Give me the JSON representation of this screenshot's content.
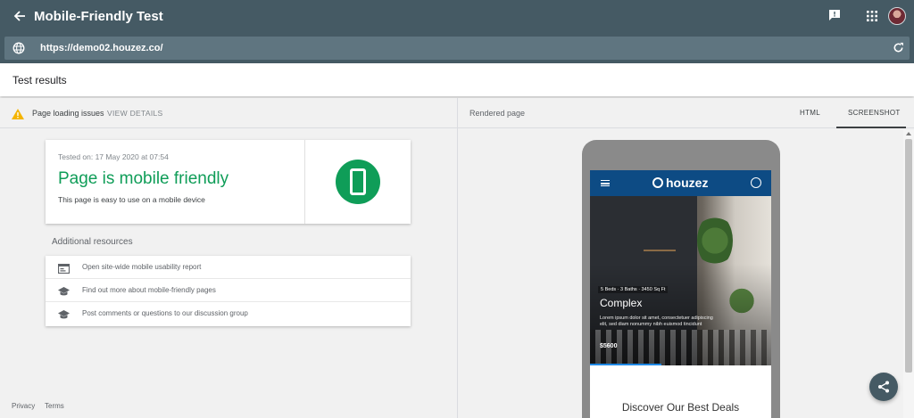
{
  "header": {
    "title": "Mobile-Friendly Test",
    "back_icon": "arrow-back-icon",
    "feedback_icon": "feedback-icon",
    "apps_icon": "apps-grid-icon",
    "avatar": "account-avatar"
  },
  "urlbar": {
    "url": "https://demo02.houzez.co/",
    "globe_icon": "globe-icon",
    "reload_icon": "refresh-icon"
  },
  "results": {
    "title": "Test results"
  },
  "issues": {
    "label": "Page loading issues",
    "action": "VIEW DETAILS",
    "icon": "warning-icon",
    "icon_color": "#f4b400"
  },
  "result_card": {
    "tested_on": "Tested on: 17 May 2020 at 07:54",
    "verdict": "Page is mobile friendly",
    "description": "This page is easy to use on a mobile device",
    "verdict_color": "#0f9d58",
    "badge_icon": "smartphone-icon"
  },
  "resources": {
    "title": "Additional resources",
    "items": [
      {
        "icon": "web-report-icon",
        "label": "Open site-wide mobile usability report"
      },
      {
        "icon": "school-icon",
        "label": "Find out more about mobile-friendly pages"
      },
      {
        "icon": "school-icon",
        "label": "Post comments or questions to our discussion group"
      }
    ]
  },
  "footer": {
    "privacy": "Privacy",
    "terms": "Terms"
  },
  "right_panel": {
    "label": "Rendered page",
    "tabs": [
      "HTML",
      "SCREENSHOT"
    ],
    "active_tab": "SCREENSHOT"
  },
  "rendered_site": {
    "logo": "houzez",
    "nav_color": "#0d4b84",
    "hero_tag": "5 Beds · 3 Baths · 3450 Sq Ft",
    "hero_title": "Complex",
    "hero_desc": "Lorem ipsum dolor sit amet, consectetuer adipiscing elit, sed diam nonummy nibh euismod tincidunt",
    "hero_price": "$5600",
    "section_title": "Discover Our Best Deals"
  },
  "share_fab": {
    "icon": "share-icon"
  }
}
